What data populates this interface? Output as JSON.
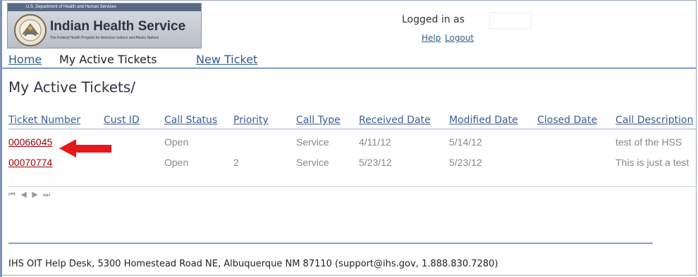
{
  "logo": {
    "department": "U.S. Department of Health and Human Services",
    "title": "Indian Health Service",
    "tagline": "The Federal Health Program for American Indians and Alaska Natives"
  },
  "header": {
    "logged_in_label": "Logged in as",
    "help": "Help",
    "logout": "Logout"
  },
  "nav": {
    "home": "Home",
    "current": "My Active Tickets",
    "new_ticket": "New Ticket"
  },
  "page": {
    "title": "My Active Tickets/"
  },
  "table": {
    "headers": [
      "Ticket Number",
      "Cust ID",
      "Call Status",
      "Priority",
      "Call Type",
      "Received Date",
      "Modified Date",
      "Closed Date",
      "Call Description"
    ],
    "rows": [
      {
        "ticket": "00066045",
        "cust_id": "",
        "status": "Open",
        "priority": "",
        "type": "Service",
        "received": "4/11/12",
        "modified": "5/14/12",
        "closed": "",
        "description": "test of the HSS"
      },
      {
        "ticket": "00070774",
        "cust_id": "",
        "status": "Open",
        "priority": "2",
        "type": "Service",
        "received": "5/23/12",
        "modified": "5/23/12",
        "closed": "",
        "description": "This is just a test"
      }
    ]
  },
  "pager": {
    "glyphs": "⏮ ◀ ▶ ⏭"
  },
  "footer": {
    "text": "IHS OIT Help Desk, 5300 Homestead Road NE, Albuquerque NM 87110 (support@ihs.gov, 1.888.830.7280)"
  },
  "colors": {
    "arrow": "#e8171c",
    "link": "#335b8f",
    "ticket_link": "#990000",
    "rule": "#7f9bc4"
  }
}
